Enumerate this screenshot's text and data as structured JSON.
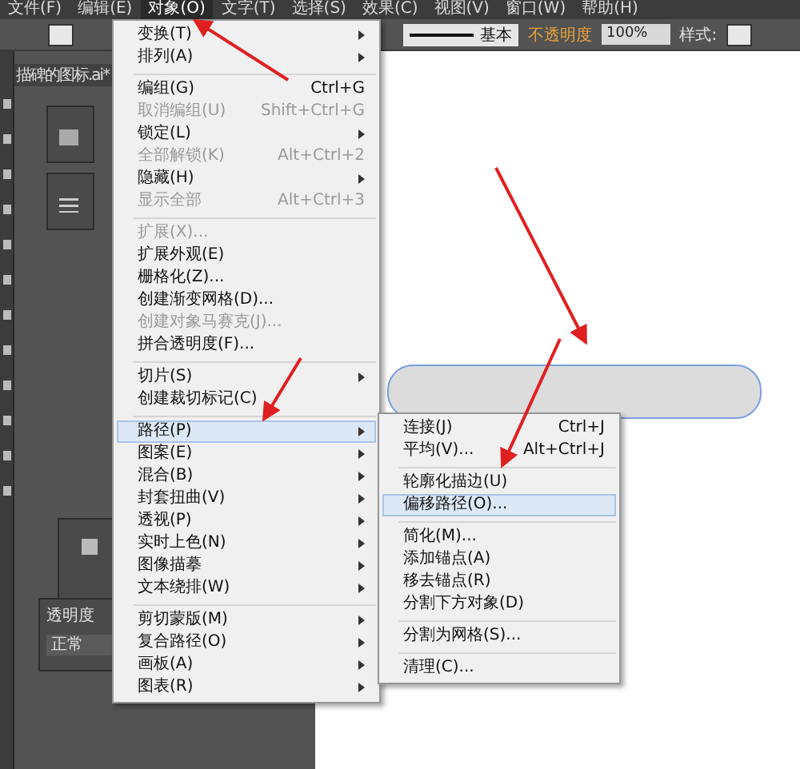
{
  "menu_bar": [
    {
      "label": "文件(F)",
      "selected": false
    },
    {
      "label": "编辑(E)",
      "selected": false
    },
    {
      "label": "对象(O)",
      "selected": true
    },
    {
      "label": "文字(T)",
      "selected": false
    },
    {
      "label": "选择(S)",
      "selected": false
    },
    {
      "label": "效果(C)",
      "selected": false
    },
    {
      "label": "视图(V)",
      "selected": false
    },
    {
      "label": "窗口(W)",
      "selected": false
    },
    {
      "label": "帮助(H)",
      "selected": false
    }
  ],
  "control_bar": {
    "stroke_style": "基本",
    "opacity_label": "不透明度",
    "opacity_value": "100%",
    "style_label": "样式:"
  },
  "document_tab": {
    "title": "描碑的图标.ai*"
  },
  "transparency_panel": {
    "title": "透明度",
    "blend_mode": "正常"
  },
  "object_menu": [
    {
      "kind": "item",
      "label": "变换(T)",
      "submenu": true,
      "disabled": false,
      "selected": false
    },
    {
      "kind": "item",
      "label": "排列(A)",
      "submenu": true,
      "disabled": false,
      "selected": false
    },
    {
      "kind": "separator"
    },
    {
      "kind": "item",
      "label": "编组(G)",
      "shortcut": "Ctrl+G",
      "submenu": false,
      "disabled": false,
      "selected": false
    },
    {
      "kind": "item",
      "label": "取消编组(U)",
      "shortcut": "Shift+Ctrl+G",
      "submenu": false,
      "disabled": true,
      "selected": false
    },
    {
      "kind": "item",
      "label": "锁定(L)",
      "submenu": true,
      "disabled": false,
      "selected": false
    },
    {
      "kind": "item",
      "label": "全部解锁(K)",
      "shortcut": "Alt+Ctrl+2",
      "submenu": false,
      "disabled": true,
      "selected": false
    },
    {
      "kind": "item",
      "label": "隐藏(H)",
      "submenu": true,
      "disabled": false,
      "selected": false
    },
    {
      "kind": "item",
      "label": "显示全部",
      "shortcut": "Alt+Ctrl+3",
      "submenu": false,
      "disabled": true,
      "selected": false
    },
    {
      "kind": "separator"
    },
    {
      "kind": "item",
      "label": "扩展(X)...",
      "submenu": false,
      "disabled": true,
      "selected": false
    },
    {
      "kind": "item",
      "label": "扩展外观(E)",
      "submenu": false,
      "disabled": false,
      "selected": false
    },
    {
      "kind": "item",
      "label": "栅格化(Z)...",
      "submenu": false,
      "disabled": false,
      "selected": false
    },
    {
      "kind": "item",
      "label": "创建渐变网格(D)...",
      "submenu": false,
      "disabled": false,
      "selected": false
    },
    {
      "kind": "item",
      "label": "创建对象马赛克(J)...",
      "submenu": false,
      "disabled": true,
      "selected": false
    },
    {
      "kind": "item",
      "label": "拼合透明度(F)...",
      "submenu": false,
      "disabled": false,
      "selected": false
    },
    {
      "kind": "separator"
    },
    {
      "kind": "item",
      "label": "切片(S)",
      "submenu": true,
      "disabled": false,
      "selected": false
    },
    {
      "kind": "item",
      "label": "创建裁切标记(C)",
      "submenu": false,
      "disabled": false,
      "selected": false
    },
    {
      "kind": "separator"
    },
    {
      "kind": "item",
      "label": "路径(P)",
      "submenu": true,
      "disabled": false,
      "selected": true
    },
    {
      "kind": "item",
      "label": "图案(E)",
      "submenu": true,
      "disabled": false,
      "selected": false
    },
    {
      "kind": "item",
      "label": "混合(B)",
      "submenu": true,
      "disabled": false,
      "selected": false
    },
    {
      "kind": "item",
      "label": "封套扭曲(V)",
      "submenu": true,
      "disabled": false,
      "selected": false
    },
    {
      "kind": "item",
      "label": "透视(P)",
      "submenu": true,
      "disabled": false,
      "selected": false
    },
    {
      "kind": "item",
      "label": "实时上色(N)",
      "submenu": true,
      "disabled": false,
      "selected": false
    },
    {
      "kind": "item",
      "label": "图像描摹",
      "submenu": true,
      "disabled": false,
      "selected": false
    },
    {
      "kind": "item",
      "label": "文本绕排(W)",
      "submenu": true,
      "disabled": false,
      "selected": false
    },
    {
      "kind": "separator"
    },
    {
      "kind": "item",
      "label": "剪切蒙版(M)",
      "submenu": true,
      "disabled": false,
      "selected": false
    },
    {
      "kind": "item",
      "label": "复合路径(O)",
      "submenu": true,
      "disabled": false,
      "selected": false
    },
    {
      "kind": "item",
      "label": "画板(A)",
      "submenu": true,
      "disabled": false,
      "selected": false
    },
    {
      "kind": "item",
      "label": "图表(R)",
      "submenu": true,
      "disabled": false,
      "selected": false
    }
  ],
  "path_submenu": [
    {
      "kind": "item",
      "label": "连接(J)",
      "shortcut": "Ctrl+J",
      "submenu": false,
      "disabled": false,
      "selected": false
    },
    {
      "kind": "item",
      "label": "平均(V)...",
      "shortcut": "Alt+Ctrl+J",
      "submenu": false,
      "disabled": false,
      "selected": false
    },
    {
      "kind": "separator"
    },
    {
      "kind": "item",
      "label": "轮廓化描边(U)",
      "submenu": false,
      "disabled": false,
      "selected": false
    },
    {
      "kind": "item",
      "label": "偏移路径(O)...",
      "submenu": false,
      "disabled": false,
      "selected": true
    },
    {
      "kind": "separator"
    },
    {
      "kind": "item",
      "label": "简化(M)...",
      "submenu": false,
      "disabled": false,
      "selected": false
    },
    {
      "kind": "item",
      "label": "添加锚点(A)",
      "submenu": false,
      "disabled": false,
      "selected": false
    },
    {
      "kind": "item",
      "label": "移去锚点(R)",
      "submenu": false,
      "disabled": false,
      "selected": false
    },
    {
      "kind": "item",
      "label": "分割下方对象(D)",
      "submenu": false,
      "disabled": false,
      "selected": false
    },
    {
      "kind": "separator"
    },
    {
      "kind": "item",
      "label": "分割为网格(S)...",
      "submenu": false,
      "disabled": false,
      "selected": false
    },
    {
      "kind": "separator"
    },
    {
      "kind": "item",
      "label": "清理(C)...",
      "submenu": false,
      "disabled": false,
      "selected": false
    }
  ]
}
